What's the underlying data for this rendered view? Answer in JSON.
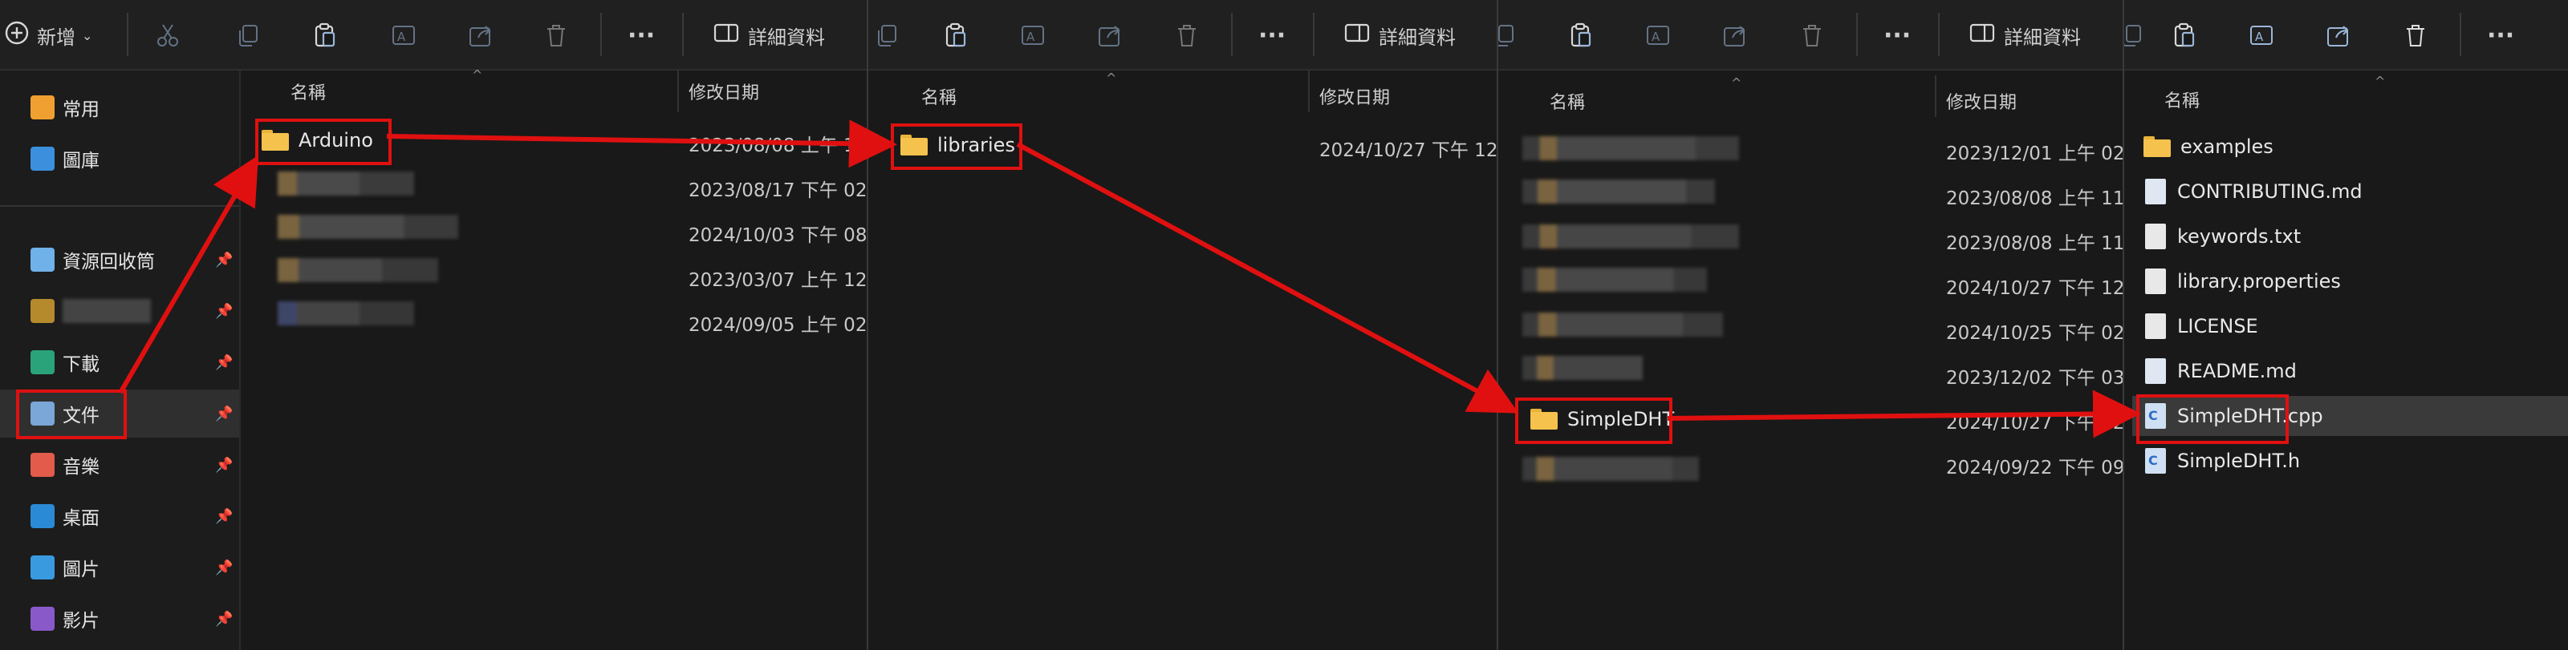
{
  "toolbar": {
    "new_label": "新增",
    "more_label": "···",
    "details_label": "詳細資料"
  },
  "columns": {
    "name": "名稱",
    "modified": "修改日期"
  },
  "sidebar": {
    "items": [
      {
        "label": "常用",
        "icon": "home-icon",
        "color": "#f0a030"
      },
      {
        "label": "圖庫",
        "icon": "gallery-icon",
        "color": "#3b8fdc"
      },
      {
        "label": "資源回收筒",
        "icon": "recycle-bin-icon",
        "color": "#6fb1e8"
      },
      {
        "label": "",
        "icon": "folder-icon",
        "color": "#b58a2c"
      },
      {
        "label": "下載",
        "icon": "downloads-icon",
        "color": "#2aa37a"
      },
      {
        "label": "文件",
        "icon": "documents-icon",
        "color": "#7aa6d8"
      },
      {
        "label": "音樂",
        "icon": "music-icon",
        "color": "#e35b4a"
      },
      {
        "label": "桌面",
        "icon": "desktop-icon",
        "color": "#2b8ad6"
      },
      {
        "label": "圖片",
        "icon": "pictures-icon",
        "color": "#3a9ae0"
      },
      {
        "label": "影片",
        "icon": "videos-icon",
        "color": "#8a59c9"
      }
    ]
  },
  "panel1": {
    "rows": [
      {
        "name": "Arduino",
        "date": "2023/08/08 上午 11"
      },
      {
        "name": "",
        "date": "2023/08/17 下午 02"
      },
      {
        "name": "",
        "date": "2024/10/03 下午 08"
      },
      {
        "name": "",
        "date": "2023/03/07 上午 12"
      },
      {
        "name": "",
        "date": "2024/09/05 上午 02"
      }
    ]
  },
  "panel2": {
    "rows": [
      {
        "name": "libraries",
        "date": "2024/10/27 下午 12"
      }
    ]
  },
  "panel3": {
    "rows": [
      {
        "name": "",
        "date": "2023/12/01 上午 02"
      },
      {
        "name": "",
        "date": "2023/08/08 上午 11"
      },
      {
        "name": "",
        "date": "2023/08/08 上午 11"
      },
      {
        "name": "",
        "date": "2024/10/27 下午 12"
      },
      {
        "name": "",
        "date": "2024/10/25 下午 02"
      },
      {
        "name": "",
        "date": "2023/12/02 下午 03"
      },
      {
        "name": "SimpleDHT",
        "date": "2024/10/27 下午 12"
      },
      {
        "name": "",
        "date": "2024/09/22 下午 09"
      }
    ]
  },
  "panel4": {
    "rows": [
      {
        "name": "examples",
        "type": "folder"
      },
      {
        "name": "CONTRIBUTING.md",
        "type": "md"
      },
      {
        "name": "keywords.txt",
        "type": "txt"
      },
      {
        "name": "library.properties",
        "type": "txt"
      },
      {
        "name": "LICENSE",
        "type": "txt"
      },
      {
        "name": "README.md",
        "type": "md"
      },
      {
        "name": "SimpleDHT.cpp",
        "type": "c"
      },
      {
        "name": "SimpleDHT.h",
        "type": "c"
      }
    ]
  },
  "colors": {
    "highlight": "#e01010",
    "folder": "#f4c24d",
    "background": "#191919"
  }
}
